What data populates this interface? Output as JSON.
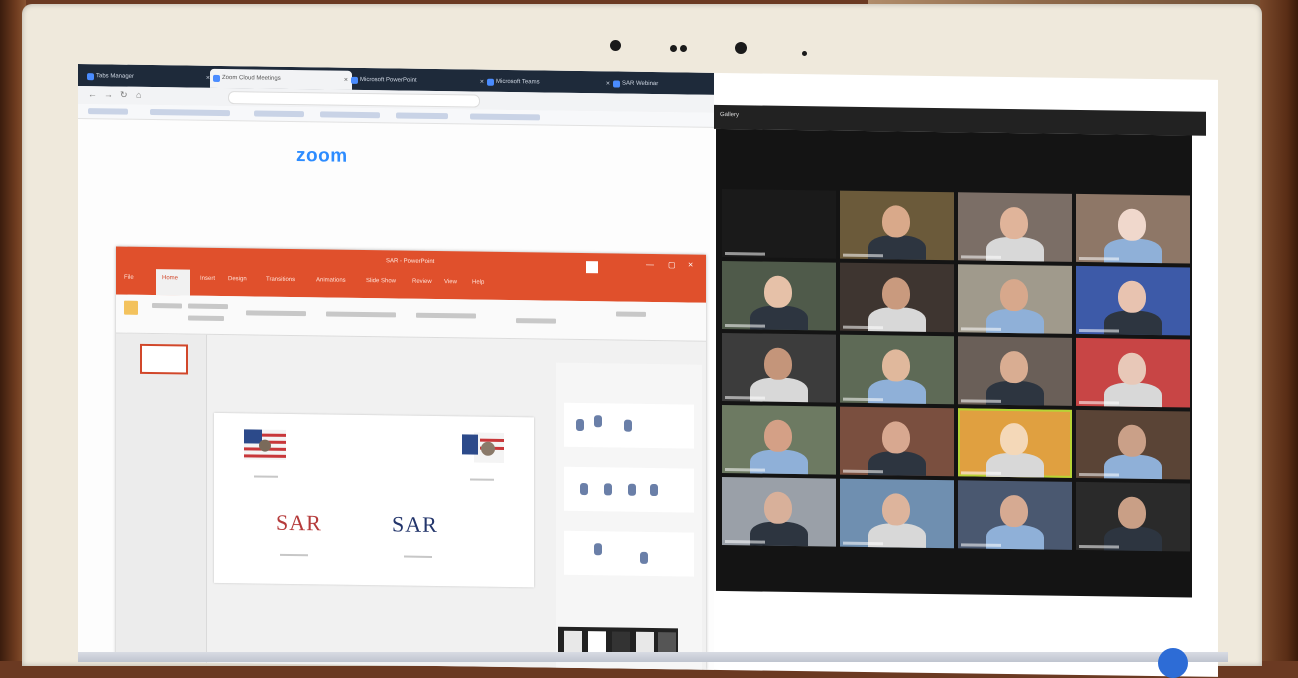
{
  "zoom_logo": "zoom",
  "browser": {
    "tabs": [
      "Tabs Manager",
      "Zoom Cloud Meetings",
      "Microsoft PowerPoint",
      "Microsoft Teams",
      "SAR Webinar"
    ]
  },
  "powerpoint": {
    "title": "SAR - PowerPoint",
    "menu": [
      "File",
      "Home",
      "Insert",
      "Design",
      "Transitions",
      "Animations",
      "Slide Show",
      "Review",
      "View",
      "Help"
    ]
  },
  "slide": {
    "logos": [
      "SAR",
      "SAR"
    ]
  },
  "zoom_meeting": {
    "view_label": "Gallery",
    "participants": [
      {
        "color": "#1a1a1a",
        "skin": "#1a1a1a"
      },
      {
        "color": "#6b5a3a",
        "skin": "#d9a98a"
      },
      {
        "color": "#7b6e66",
        "skin": "#e0b49a"
      },
      {
        "color": "#8e7767",
        "skin": "#f0d8cc"
      },
      {
        "color": "#4f5a4a",
        "skin": "#e6c1a8"
      },
      {
        "color": "#3e3530",
        "skin": "#c99a7e"
      },
      {
        "color": "#a09a8c",
        "skin": "#d7a88c"
      },
      {
        "color": "#3d5aa8",
        "skin": "#e8c3b0"
      },
      {
        "color": "#3c3c3c",
        "skin": "#c4957a"
      },
      {
        "color": "#5e6a56",
        "skin": "#e0b89c"
      },
      {
        "color": "#6a5f58",
        "skin": "#d9ad92"
      },
      {
        "color": "#c84545",
        "skin": "#e8c8b8"
      },
      {
        "color": "#6d7a62",
        "skin": "#d4a086"
      },
      {
        "color": "#7a4f3f",
        "skin": "#d8a890"
      },
      {
        "color": "#e0a040",
        "skin": "#f4d8b8"
      },
      {
        "color": "#5a4436",
        "skin": "#caa088"
      },
      {
        "color": "#9aa0a8",
        "skin": "#d8b09a"
      },
      {
        "color": "#6f8fb0",
        "skin": "#ddb49c"
      },
      {
        "color": "#4a5870",
        "skin": "#d6aa92"
      },
      {
        "color": "#2a2a2a",
        "skin": "#c99f86"
      }
    ]
  }
}
